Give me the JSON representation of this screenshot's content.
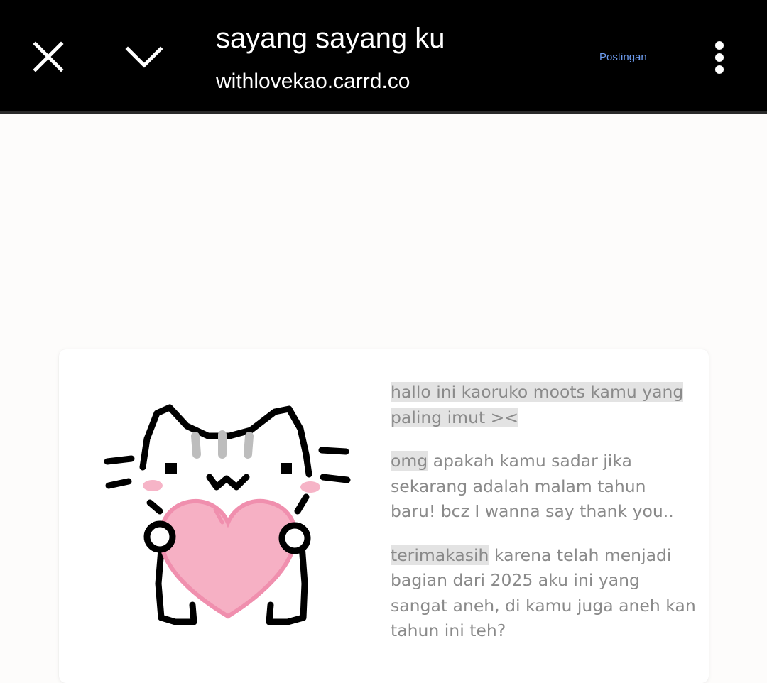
{
  "header": {
    "title": "sayang sayang ku",
    "url": "withlovekao.carrd.co",
    "postingan_label": "Postingan",
    "close_icon": "close-icon",
    "collapse_icon": "chevron-down-icon",
    "menu_icon": "more-vertical-icon",
    "background_color": "#000000",
    "link_color": "#6e9df0"
  },
  "card": {
    "image": "cat-holding-heart-illustration",
    "paragraphs": [
      {
        "highlight": "hallo ini kaoruko moots kamu yang paling imut ><",
        "rest": ""
      },
      {
        "highlight": "omg",
        "rest": " apakah kamu sadar jika sekarang adalah malam tahun baru! bcz I wanna say thank you.."
      },
      {
        "highlight": "terimakasih",
        "rest": " karena telah menjadi bagian dari 2025 aku ini yang sangat aneh, di kamu juga aneh kan tahun ini teh?"
      }
    ],
    "text_color": "#8a8a8a",
    "highlight_color": "#e3e3e3"
  }
}
